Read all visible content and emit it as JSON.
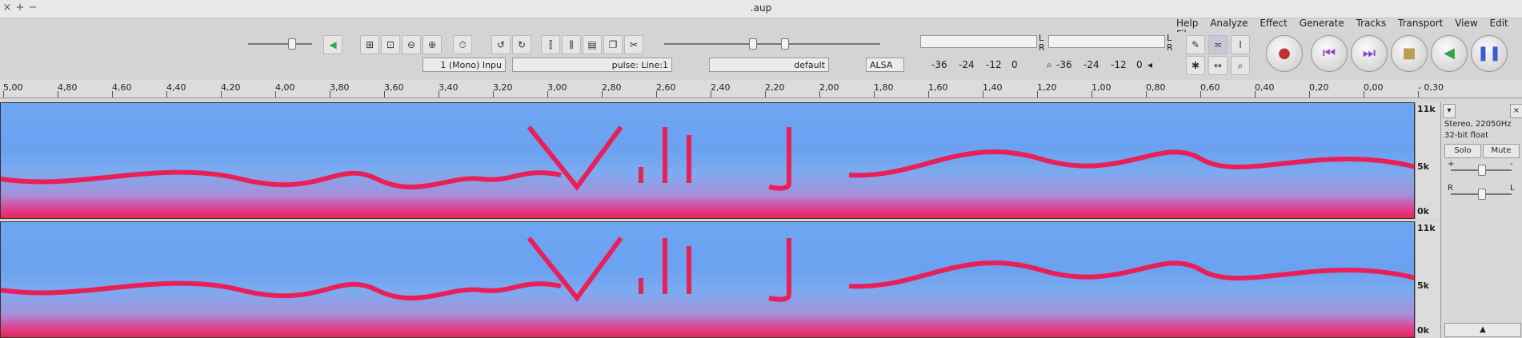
{
  "window": {
    "title": ".aup",
    "buttons": [
      "×",
      "+",
      "−"
    ]
  },
  "menu": [
    "Help",
    "Analyze",
    "Effect",
    "Generate",
    "Tracks",
    "Transport",
    "View",
    "Edit",
    "File"
  ],
  "meters": {
    "playback_label": "L\nR",
    "scale_rec": [
      "-36",
      "-24",
      "-12",
      "0"
    ],
    "scale_play": [
      "-36",
      "-24",
      "-12",
      "0"
    ]
  },
  "devices": {
    "host": "ALSA",
    "output": "default",
    "input": "pulse: Line:1",
    "channels": "1 (Mono) Inpu"
  },
  "ruler_ticks": [
    "5,00",
    "4,80",
    "4,60",
    "4,40",
    "4,20",
    "4,00",
    "3,80",
    "3,60",
    "3,40",
    "3,20",
    "3,00",
    "2,80",
    "2,60",
    "2,40",
    "2,20",
    "2,00",
    "1,80",
    "1,60",
    "1,40",
    "1,20",
    "1,00",
    "0,80",
    "0,60",
    "0,40",
    "0,20",
    "0,00",
    "- 0,30"
  ],
  "track": {
    "info_line1": "Stereo, 22050Hz",
    "info_line2": "32-bit float",
    "mute": "Mute",
    "solo": "Solo",
    "gain_plus": "+",
    "gain_minus": "-",
    "pan_left": "L",
    "pan_right": "R",
    "scale_top": "11k",
    "scale_mid": "5k",
    "scale_bottom": "0k"
  },
  "colors": {
    "spectrogram_bg": "#6ea6f4",
    "curve": "#e8205a",
    "bottom_band": "#e02858"
  },
  "icons": [
    "close-icon",
    "plus-icon",
    "minus-icon",
    "pause-icon",
    "play-icon",
    "stop-icon",
    "skip-start-icon",
    "skip-end-icon",
    "record-icon",
    "select-tool-icon",
    "envelope-tool-icon",
    "draw-tool-icon",
    "zoom-tool-icon",
    "timeshift-tool-icon",
    "multi-tool-icon",
    "mic-icon",
    "speaker-icon"
  ]
}
